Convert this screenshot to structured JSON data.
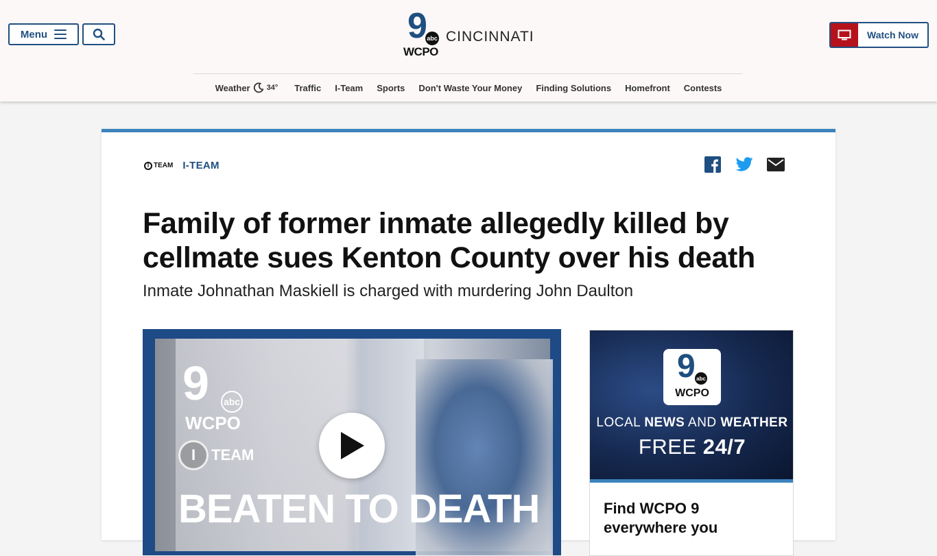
{
  "header": {
    "menu_label": "Menu",
    "logo": {
      "nine": "9",
      "abc": "abc",
      "wcpo": "WCPO",
      "city": "CINCINNATI"
    },
    "watch_now_label": "Watch Now"
  },
  "nav": {
    "weather_label": "Weather",
    "weather_temp": "34°",
    "items": [
      "Traffic",
      "I-Team",
      "Sports",
      "Don't Waste Your Money",
      "Finding Solutions",
      "Homefront",
      "Contests"
    ]
  },
  "article": {
    "section_logo_text": "TEAM",
    "section": "I-TEAM",
    "headline": "Family of former inmate allegedly killed by cellmate sues Kenton County over his death",
    "subhead": "Inmate Johnathan Maskiell is charged with murdering John Daulton"
  },
  "video": {
    "nine": "9",
    "abc": "abc",
    "wcpo": "WCPO",
    "iteam_ring": "I",
    "iteam_text": "TEAM",
    "title": "BEATEN TO DEATH"
  },
  "promo": {
    "nine": "9",
    "abc": "abc",
    "wcpo": "WCPO",
    "line1_prefix": "LOCAL ",
    "line1_news": "NEWS",
    "line1_mid": " AND ",
    "line1_weather": "WEATHER",
    "line2_free": "FREE ",
    "line2_247": "24/7",
    "body": "Find WCPO 9 everywhere you"
  },
  "colors": {
    "brand_blue": "#1f4f80",
    "accent_blue": "#3c82bd",
    "watch_red": "#b5121b",
    "facebook": "#1f4f80",
    "twitter": "#1d9bf0"
  }
}
